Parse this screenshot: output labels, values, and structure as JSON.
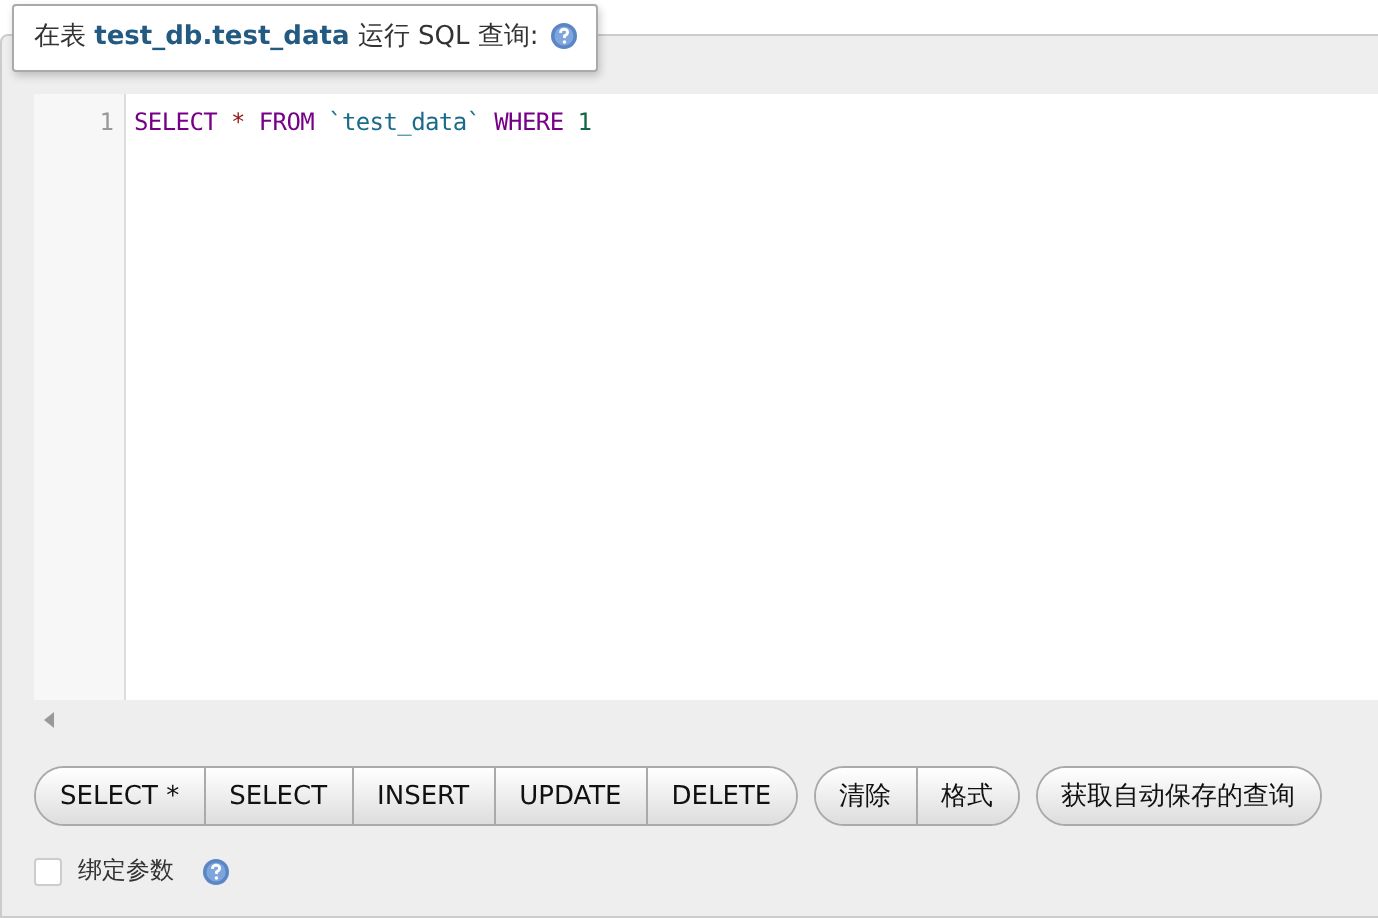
{
  "legend": {
    "prefix": "在表",
    "table": "test_db.test_data",
    "suffix": "运行 SQL 查询:"
  },
  "editor": {
    "lines": [
      {
        "number": "1",
        "tokens": [
          {
            "kind": "keyword",
            "text": "SELECT"
          },
          {
            "kind": "operator",
            "text": "*"
          },
          {
            "kind": "keyword",
            "text": "FROM"
          },
          {
            "kind": "string",
            "text": "`test_data`"
          },
          {
            "kind": "keyword",
            "text": "WHERE"
          },
          {
            "kind": "number",
            "text": "1"
          }
        ]
      }
    ]
  },
  "button_groups": [
    [
      "SELECT *",
      "SELECT",
      "INSERT",
      "UPDATE",
      "DELETE"
    ],
    [
      "清除",
      "格式"
    ],
    [
      "获取自动保存的查询"
    ]
  ],
  "bind_parameters": {
    "label": "绑定参数",
    "checked": false
  }
}
